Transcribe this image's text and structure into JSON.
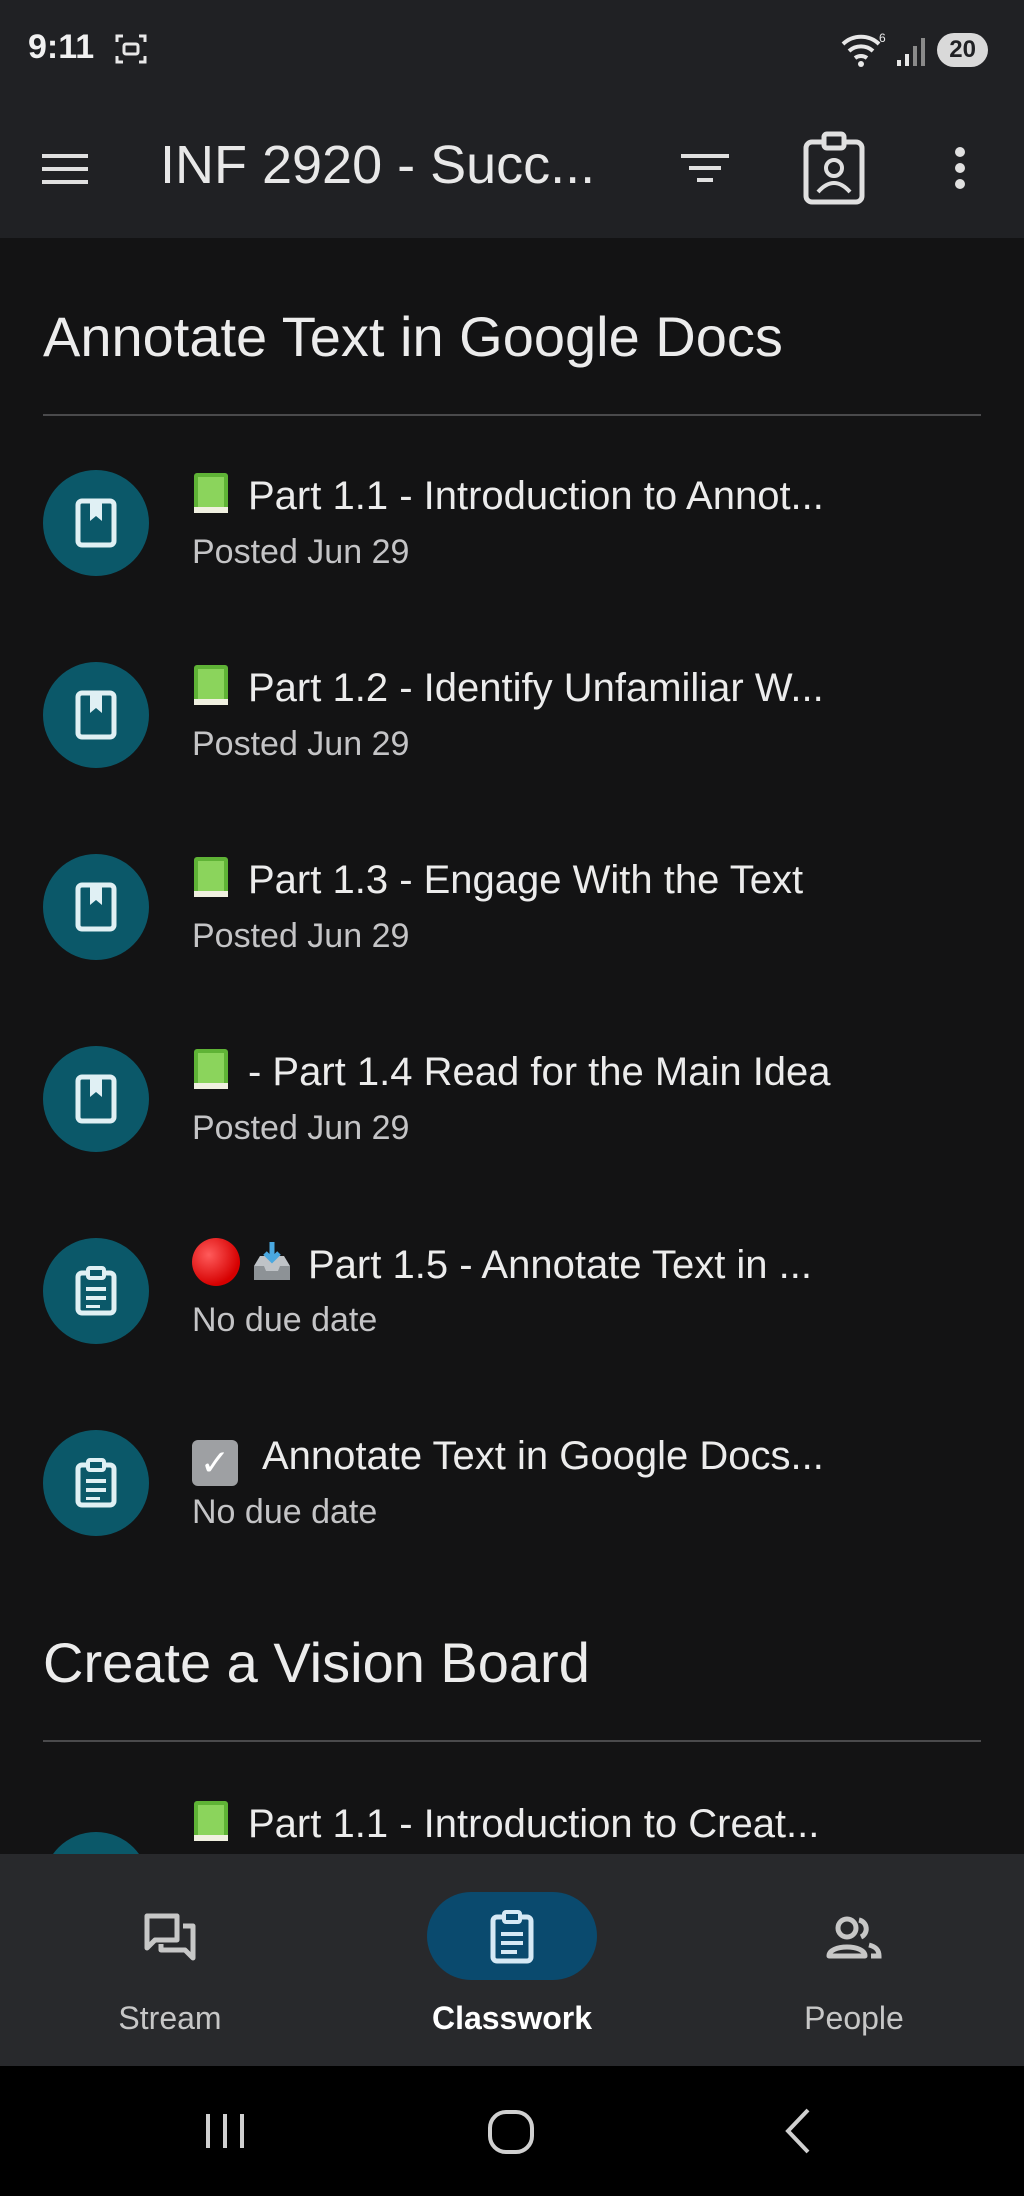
{
  "status_bar": {
    "time": "9:11",
    "battery": "20",
    "wifi_badge": "6"
  },
  "app_bar": {
    "title": "INF 2920 - Succ..."
  },
  "sections": [
    {
      "title": "Annotate Text in Google Docs",
      "items": [
        {
          "emoji": "green-book",
          "title": "Part 1.1 - Introduction to Annot...",
          "subtitle": "Posted Jun 29",
          "icon": "book-icon"
        },
        {
          "emoji": "green-book",
          "title": "Part 1.2 - Identify Unfamiliar W...",
          "subtitle": "Posted Jun 29",
          "icon": "book-icon"
        },
        {
          "emoji": "green-book",
          "title": "Part 1.3 - Engage With the Text",
          "subtitle": "Posted Jun 29",
          "icon": "book-icon"
        },
        {
          "emoji": "green-book",
          "title": "- Part 1.4 Read for the Main Idea",
          "subtitle": "Posted Jun 29",
          "icon": "book-icon"
        },
        {
          "emoji": "red-circle inbox-tray",
          "title": "Part 1.5 - Annotate Text in ...",
          "subtitle": "No due date",
          "icon": "assignment-icon"
        },
        {
          "emoji": "check-box",
          "title": "Annotate Text in Google Docs...",
          "subtitle": "No due date",
          "icon": "assignment-icon"
        }
      ]
    },
    {
      "title": "Create a Vision Board",
      "items": [
        {
          "emoji": "green-book",
          "title": "Part 1.1 - Introduction to Creat...",
          "icon": "book-icon"
        }
      ]
    }
  ],
  "bottom_nav": {
    "items": [
      {
        "label": "Stream",
        "icon": "stream-icon",
        "active": false
      },
      {
        "label": "Classwork",
        "icon": "classwork-icon",
        "active": true
      },
      {
        "label": "People",
        "icon": "people-icon",
        "active": false
      }
    ]
  },
  "colors": {
    "background": "#131314",
    "bar": "#202124",
    "icon_circle": "#0b5869",
    "active_pill": "#0a4a6e"
  }
}
